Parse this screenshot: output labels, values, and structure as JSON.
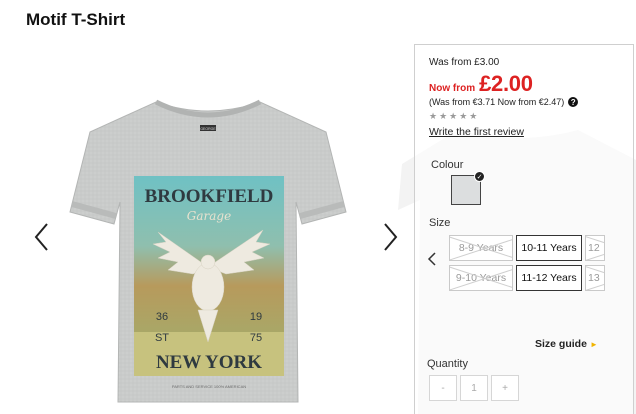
{
  "product": {
    "title": "Motif T-Shirt"
  },
  "gallery": {
    "prev_label": "previous image",
    "next_label": "next image",
    "print": {
      "brand_top": "BROOKFIELD",
      "script": "Garage",
      "num_left_1": "36",
      "num_left_2": "ST",
      "num_right_1": "19",
      "num_right_2": "75",
      "city": "NEW YORK",
      "tagline": "PARTS AND SERVICE 100% AMERICAN",
      "label": "GEORGE"
    }
  },
  "pricing": {
    "was_from": "Was from £3.00",
    "now_label": "Now from",
    "now_price": "£2.00",
    "was_note": "(Was from €3.71 Now from €2.47)",
    "help_icon": "?"
  },
  "rating": {
    "stars": "★★★★★",
    "review_link": "Write the first review"
  },
  "colour": {
    "label": "Colour",
    "selected_check": "✓"
  },
  "size": {
    "label": "Size",
    "options": [
      "8-9 Years",
      "10-11 Years",
      "12",
      "9-10 Years",
      "11-12 Years",
      "13"
    ],
    "available": [
      false,
      true,
      false,
      false,
      true,
      false
    ]
  },
  "size_guide": {
    "label": "Size guide",
    "icon": "►"
  },
  "quantity": {
    "label": "Quantity",
    "minus": "-",
    "value": "1",
    "plus": "+"
  }
}
